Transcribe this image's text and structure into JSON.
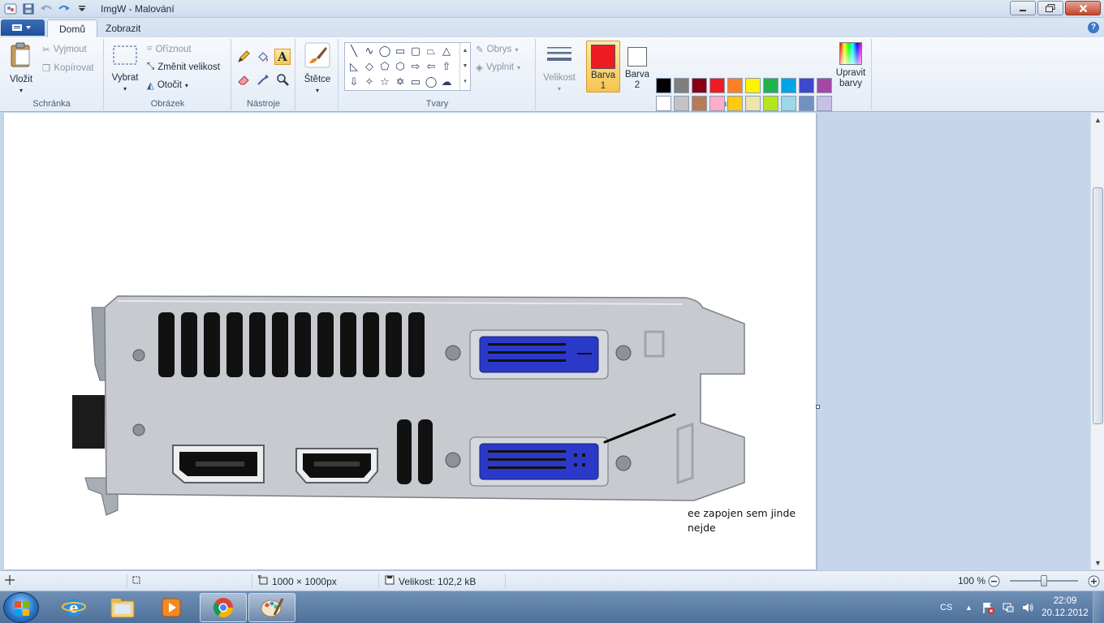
{
  "window": {
    "title": "ImgW - Malování",
    "controls": [
      "minimize",
      "maximize",
      "close"
    ]
  },
  "tabs": [
    {
      "label": "Domů",
      "active": true
    },
    {
      "label": "Zobrazit",
      "active": false
    }
  ],
  "ribbon": {
    "clipboard": {
      "label": "Schránka",
      "paste": "Vložit",
      "cut": "Vyjmout",
      "copy": "Kopírovat"
    },
    "image": {
      "label": "Obrázek",
      "select": "Vybrat",
      "crop": "Oříznout",
      "resize": "Změnit velikost",
      "rotate": "Otočit"
    },
    "tools": {
      "label": "Nástroje"
    },
    "brushes": {
      "label": "Štětce"
    },
    "shapes": {
      "label": "Tvary",
      "outline": "Obrys",
      "fill": "Vyplnit"
    },
    "size": {
      "label": "Velikost"
    },
    "colors": {
      "label": "Barvy",
      "color1_line1": "Barva",
      "color1_line2": "1",
      "color2_line1": "Barva",
      "color2_line2": "2",
      "edit_line1": "Upravit",
      "edit_line2": "barvy",
      "color1_value": "#ed1c24",
      "color2_value": "#ffffff",
      "palette_row1": [
        "#000000",
        "#7f7f7f",
        "#880015",
        "#ed1c24",
        "#ff7f27",
        "#fff200",
        "#22b14c",
        "#00a2e8",
        "#3f48cc",
        "#a349a4"
      ],
      "palette_row2": [
        "#ffffff",
        "#c3c3c3",
        "#b97a57",
        "#ffaec9",
        "#ffc90e",
        "#efe4b0",
        "#b5e61d",
        "#99d9ea",
        "#7092be",
        "#c8bfe7"
      ],
      "palette_row3_empty": 10
    }
  },
  "canvas": {
    "annotation_line1": "ee zapojen sem jinde",
    "annotation_line2": "nejde",
    "image_subject": "graphics-card-bracket-with-dvi-hdmi-displayport"
  },
  "status": {
    "dimensions": "1000 × 1000px",
    "size": "Velikost: 102,2 kB",
    "zoom": "100 %",
    "zoom_level": 1.0
  },
  "taskbar": {
    "apps": [
      "internet-explorer",
      "file-explorer",
      "media-player",
      "chrome",
      "paint"
    ],
    "language": "CS",
    "time": "22:09",
    "date": "20.12.2012"
  }
}
